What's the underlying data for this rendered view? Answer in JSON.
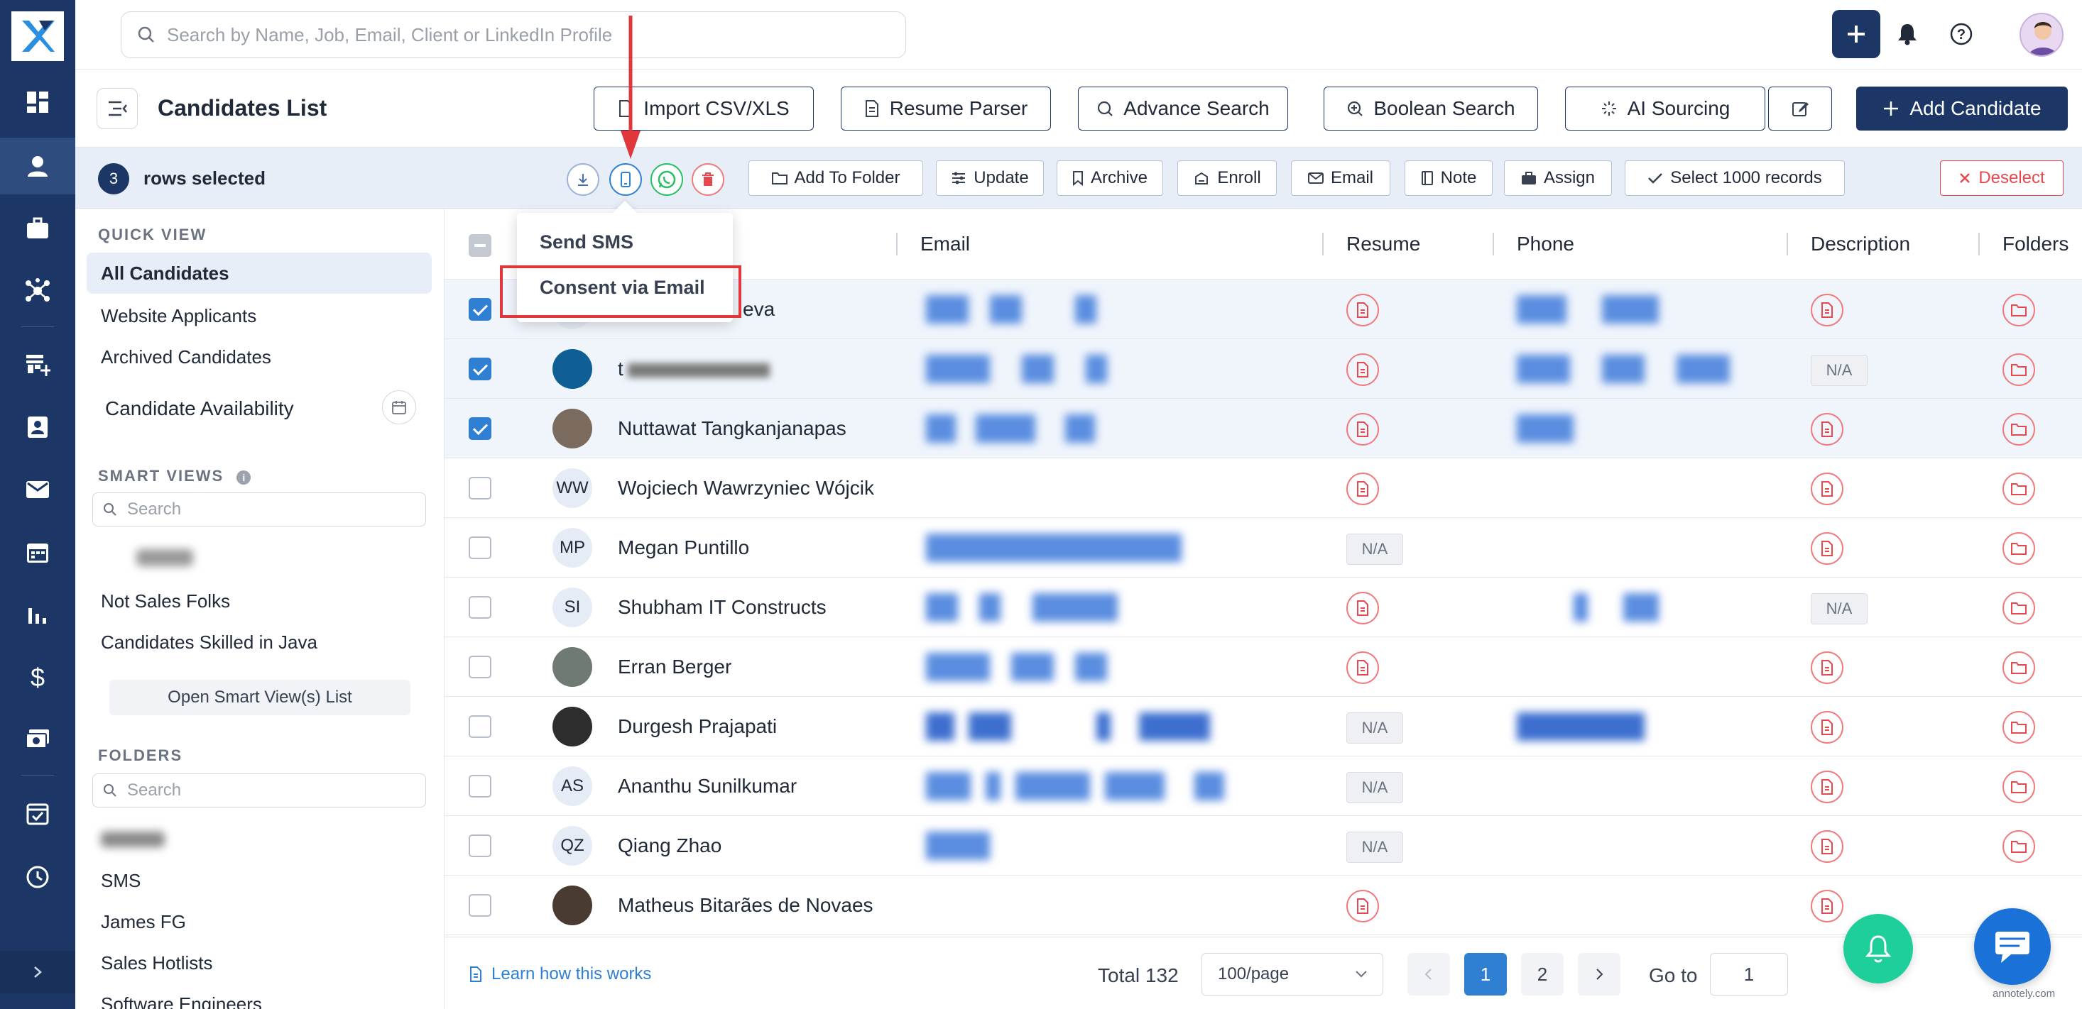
{
  "app": {
    "search_placeholder": "Search by Name, Job, Email, Client or LinkedIn Profile"
  },
  "header": {
    "title": "Candidates List",
    "buttons": [
      "Import CSV/XLS",
      "Resume Parser",
      "Advance Search",
      "Boolean Search",
      "AI Sourcing"
    ],
    "add_candidate": "Add Candidate"
  },
  "selection": {
    "count": "3",
    "label": "rows selected",
    "actions": [
      "Add To Folder",
      "Update",
      "Archive",
      "Enroll",
      "Email",
      "Note",
      "Assign",
      "Select 1000 records",
      "Deselect"
    ]
  },
  "dropdown": {
    "items": [
      "Send SMS",
      "Consent via Email"
    ]
  },
  "sidebar": {
    "quick_view_title": "QUICK VIEW",
    "quick_view": [
      "All Candidates",
      "Website Applicants",
      "Archived Candidates"
    ],
    "availability": "Candidate Availability",
    "smart_views_title": "SMART VIEWS",
    "smart_search_placeholder": "Search",
    "smart_views": [
      "Not Sales Folks",
      "Candidates Skilled in Java"
    ],
    "open_smart_views": "Open Smart View(s) List",
    "folders_title": "FOLDERS",
    "folder_search_placeholder": "Search",
    "folders": [
      "SMS",
      "James FG",
      "Sales Hotlists",
      "Software Engineers"
    ]
  },
  "table": {
    "columns": [
      "Email",
      "Resume",
      "Phone",
      "Description",
      "Folders"
    ],
    "na_label": "N/A",
    "rows": [
      {
        "initials": "",
        "name": "eva",
        "selected": true
      },
      {
        "initials": "",
        "name": "t",
        "selected": true
      },
      {
        "initials": "",
        "name": "Nuttawat Tangkanjanapas",
        "selected": true
      },
      {
        "initials": "WW",
        "name": "Wojciech Wawrzyniec Wójcik",
        "selected": false
      },
      {
        "initials": "MP",
        "name": "Megan Puntillo",
        "selected": false
      },
      {
        "initials": "SI",
        "name": "Shubham IT Constructs",
        "selected": false
      },
      {
        "initials": "",
        "name": "Erran Berger",
        "selected": false
      },
      {
        "initials": "",
        "name": "Durgesh Prajapati",
        "selected": false
      },
      {
        "initials": "AS",
        "name": "Ananthu Sunilkumar",
        "selected": false
      },
      {
        "initials": "QZ",
        "name": "Qiang Zhao",
        "selected": false
      },
      {
        "initials": "",
        "name": "Matheus Bitarães de Novaes",
        "selected": false
      }
    ]
  },
  "footer": {
    "learn": "Learn how this works",
    "total": "Total 132",
    "per_page": "100/page",
    "pages": [
      "1",
      "2"
    ],
    "goto_label": "Go to",
    "goto_value": "1"
  },
  "watermark": "annotely.com",
  "colors": {
    "brand": "#1c3766",
    "accent": "#2f7fd3",
    "danger": "#e5484d",
    "success": "#1fcf9b"
  }
}
